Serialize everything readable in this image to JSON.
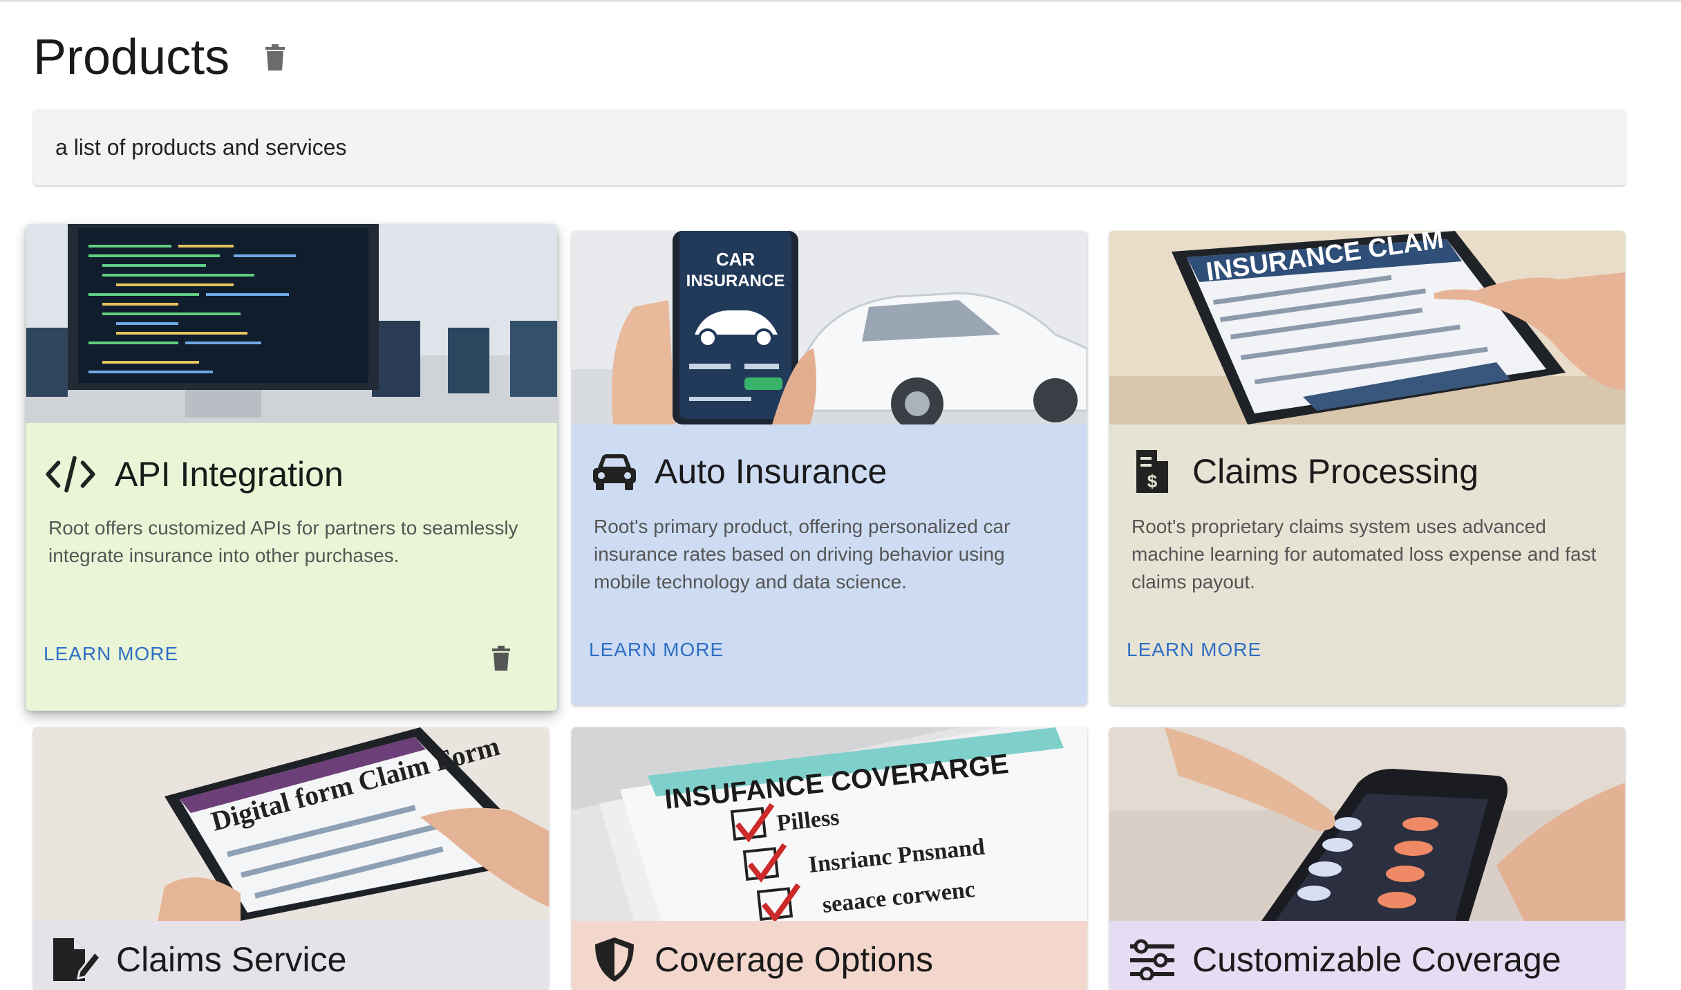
{
  "page": {
    "title": "Products",
    "description": "a list of products and services"
  },
  "colors": {
    "api_bg": "#e9f5d6",
    "auto_bg": "#cddcf2",
    "claims_bg": "#e6e3d4",
    "claims_service_bg": "#e6e2ea",
    "coverage_bg": "#f4d7cc",
    "custom_bg": "#e6dcf3",
    "link": "#2f6fc4"
  },
  "cards": [
    {
      "title": "API Integration",
      "icon": "code-icon",
      "description": "Root offers customized APIs for partners to seamlessly integrate insurance into other purchases.",
      "action": "LEARN MORE"
    },
    {
      "title": "Auto Insurance",
      "icon": "car-icon",
      "image_text_1": "CAR",
      "image_text_2": "INSURANCE",
      "description": "Root's primary product, offering personalized car insurance rates based on driving behavior using mobile technology and data science.",
      "action": "LEARN MORE"
    },
    {
      "title": "Claims Processing",
      "icon": "invoice-dollar-icon",
      "image_text": "INSURANCE CLAM",
      "description": "Root's proprietary claims system uses advanced machine learning for automated loss expense and fast claims payout.",
      "action": "LEARN MORE"
    },
    {
      "title": "Claims Service",
      "icon": "file-edit-icon",
      "image_text": "Digital form Claim Form"
    },
    {
      "title": "Coverage Options",
      "icon": "shield-icon",
      "image_text": "INSUFANCE COVERARGE",
      "image_items": [
        "Pilless",
        "Insrianc Pnsnand",
        "seaace corwenc"
      ]
    },
    {
      "title": "Customizable Coverage",
      "icon": "sliders-icon"
    }
  ]
}
